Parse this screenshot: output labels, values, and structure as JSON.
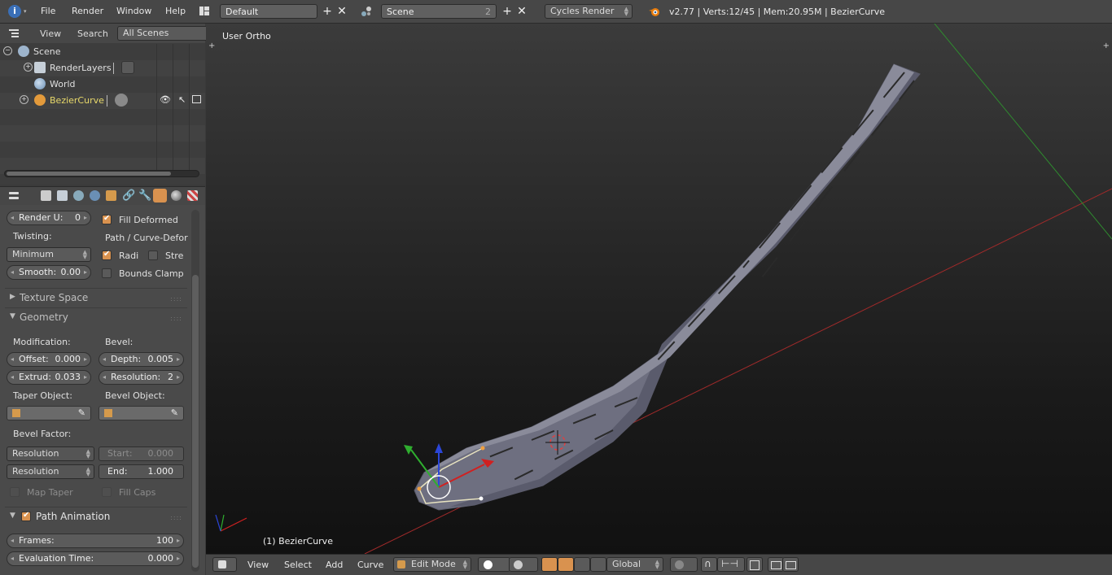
{
  "topbar": {
    "menus": [
      "File",
      "Render",
      "Window",
      "Help"
    ],
    "screen_layout": "Default",
    "scene": "Scene",
    "scene_users": "2",
    "render_engine": "Cycles Render",
    "status": "v2.77 | Verts:12/45 | Mem:20.95M | BezierCurve"
  },
  "outliner": {
    "menus": [
      "View",
      "Search"
    ],
    "filter": "All Scenes",
    "items": [
      {
        "label": "Scene"
      },
      {
        "label": "RenderLayers"
      },
      {
        "label": "World"
      },
      {
        "label": "BezierCurve"
      }
    ]
  },
  "props": {
    "render_u_label": "Render U:",
    "render_u_value": "0",
    "fill_deformed": "Fill Deformed",
    "twisting_label": "Twisting:",
    "twisting_value": "Minimum",
    "path_curve_label": "Path / Curve-Defor",
    "radius_label": "Radi",
    "stretch_label": "Stre",
    "smooth_label": "Smooth:",
    "smooth_value": "0.00",
    "bounds_clamp": "Bounds Clamp",
    "texture_space": "Texture Space",
    "geometry": "Geometry",
    "modification_label": "Modification:",
    "bevel_label": "Bevel:",
    "offset_label": "Offset:",
    "offset_value": "0.000",
    "depth_label": "Depth:",
    "depth_value": "0.005",
    "extrude_label": "Extrud:",
    "extrude_value": "0.033",
    "resolution_label": "Resolution:",
    "resolution_value": "2",
    "taper_object": "Taper Object:",
    "bevel_object": "Bevel Object:",
    "bevel_factor": "Bevel Factor:",
    "bf_mode_1": "Resolution",
    "bf_mode_2": "Resolution",
    "start_label": "Start:",
    "start_value": "0.000",
    "end_label": "End:",
    "end_value": "1.000",
    "map_taper": "Map Taper",
    "fill_caps": "Fill Caps",
    "path_animation": "Path Animation",
    "frames_label": "Frames:",
    "frames_value": "100",
    "eval_time_label": "Evaluation Time:",
    "eval_time_value": "0.000"
  },
  "viewport": {
    "view_name": "User Ortho",
    "object_label": "(1) BezierCurve"
  },
  "bottombar": {
    "menus": [
      "View",
      "Select",
      "Add",
      "Curve"
    ],
    "mode": "Edit Mode",
    "orientation": "Global"
  },
  "colors": {
    "accent": "#d9924f",
    "selected_object_text": "#e8d96a",
    "x_axis": "#c0392b",
    "y_axis": "#3cb043"
  }
}
